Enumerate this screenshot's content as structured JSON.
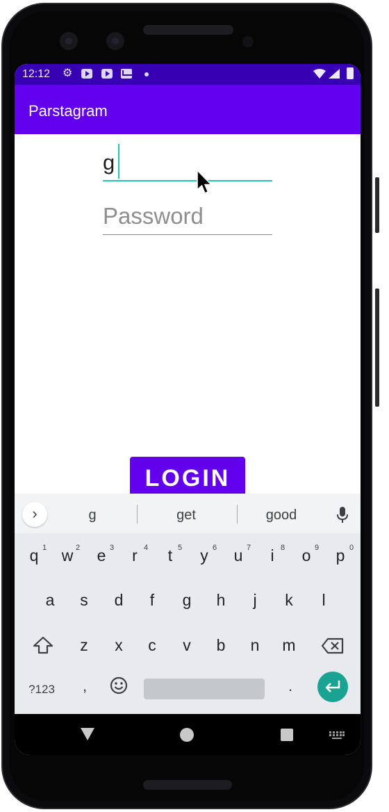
{
  "status_bar": {
    "time": "12:12",
    "icons": [
      "settings-icon",
      "youtube-icon",
      "youtube-icon",
      "gmail-icon",
      "notification-dot-icon",
      "wifi-icon",
      "signal-icon",
      "battery-icon"
    ]
  },
  "app_bar": {
    "title": "Parstagram"
  },
  "form": {
    "username_value": "g",
    "password_placeholder": "Password",
    "login_label": "LOGIN"
  },
  "keyboard": {
    "suggestions": [
      "g",
      "get",
      "good"
    ],
    "row1": [
      "q",
      "w",
      "e",
      "r",
      "t",
      "y",
      "u",
      "i",
      "o",
      "p"
    ],
    "row1_hints": [
      "1",
      "2",
      "3",
      "4",
      "5",
      "6",
      "7",
      "8",
      "9",
      "0"
    ],
    "row2": [
      "a",
      "s",
      "d",
      "f",
      "g",
      "h",
      "j",
      "k",
      "l"
    ],
    "row3": [
      "z",
      "x",
      "c",
      "v",
      "b",
      "n",
      "m"
    ],
    "symbols_label": "?123",
    "comma": ",",
    "period": "."
  },
  "colors": {
    "status_bar": "#3700b3",
    "app_bar": "#6200ee",
    "accent": "#26c6b8",
    "button": "#6200ee",
    "keyboard_bg": "#e8eaed",
    "enter_key": "#1aa393"
  }
}
